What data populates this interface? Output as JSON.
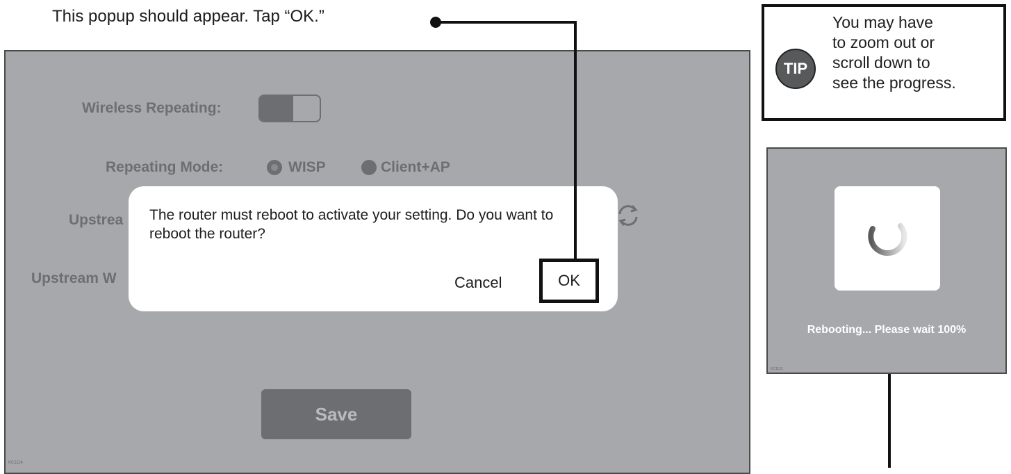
{
  "caption": "This popup should appear.  Tap “OK.”",
  "left_panel": {
    "wireless_repeating_label": "Wireless Repeating:",
    "repeating_mode_label": "Repeating Mode:",
    "modes": [
      "WISP",
      "Client+AP"
    ],
    "upstream_label_1": "Upstrea",
    "upstream_label_2": "Upstream W",
    "save_label": "Save",
    "code": "KC1114"
  },
  "dialog": {
    "message": "The router must reboot to activate your setting.  Do you want to reboot the router?",
    "cancel_label": "Cancel",
    "ok_label": "OK"
  },
  "tip": {
    "badge": "TIP",
    "text_lines": [
      "You may have",
      "to zoom out or",
      "scroll down to",
      "see the progress."
    ]
  },
  "right_panel": {
    "status": "Rebooting... Please wait 100%",
    "progress_percent": 100,
    "code": "KC1115"
  },
  "colors": {
    "overlay_gray": "#a7a8ab",
    "dim_text": "#6d6e71",
    "callout_black": "#111111"
  }
}
